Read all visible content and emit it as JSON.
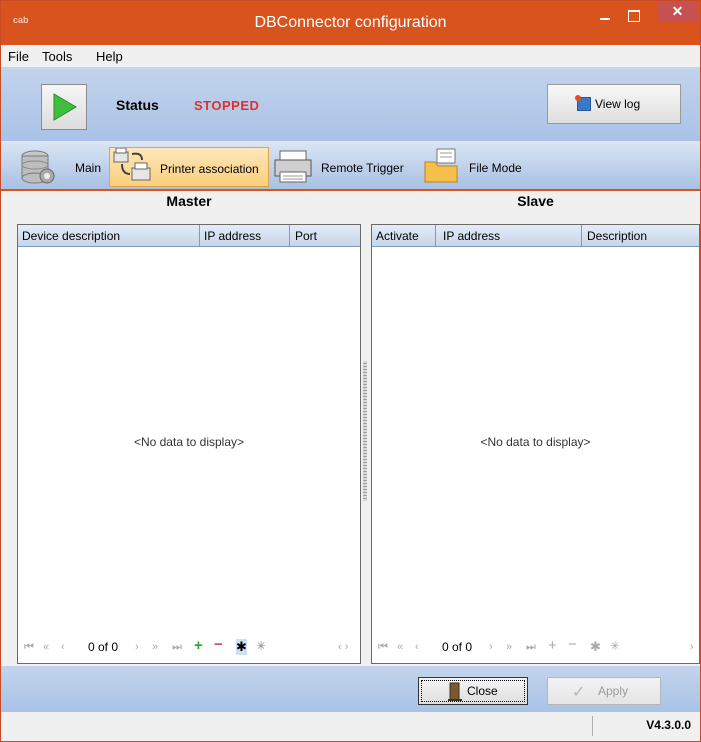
{
  "window": {
    "logo_text": "cab",
    "title": "DBConnector configuration",
    "minimize_glyph": "",
    "close_glyph": "✕"
  },
  "menu": [
    {
      "label": "File"
    },
    {
      "label": "Tools"
    },
    {
      "label": "Help"
    }
  ],
  "toolbar": {
    "status_label": "Status",
    "status_value": "STOPPED",
    "status_color": "#e03030",
    "view_log_label": "View log"
  },
  "tabs": [
    {
      "label": "Main",
      "icon": "database-gear-icon",
      "active": false
    },
    {
      "label": "Printer association",
      "icon": "printer-association-icon",
      "active": true
    },
    {
      "label": "Remote Trigger",
      "icon": "printer-icon",
      "active": false
    },
    {
      "label": "File Mode",
      "icon": "folder-file-icon",
      "active": false
    }
  ],
  "master": {
    "heading": "Master",
    "columns": [
      "Device description",
      "IP address",
      "Port"
    ],
    "empty_text": "<No data to display>",
    "nav": {
      "count": "0 of 0"
    }
  },
  "slave": {
    "heading": "Slave",
    "columns": [
      "Activate",
      "IP address",
      "Description"
    ],
    "empty_text": "<No data to display>",
    "nav": {
      "count": "0 of 0"
    }
  },
  "buttons": {
    "close_label": "Close",
    "apply_label": "Apply"
  },
  "statusbar": {
    "version": "V4.3.0.0"
  },
  "colors": {
    "titlebar": "#d9531e",
    "accent": "#d9531e",
    "band": "#a9c2e6"
  }
}
